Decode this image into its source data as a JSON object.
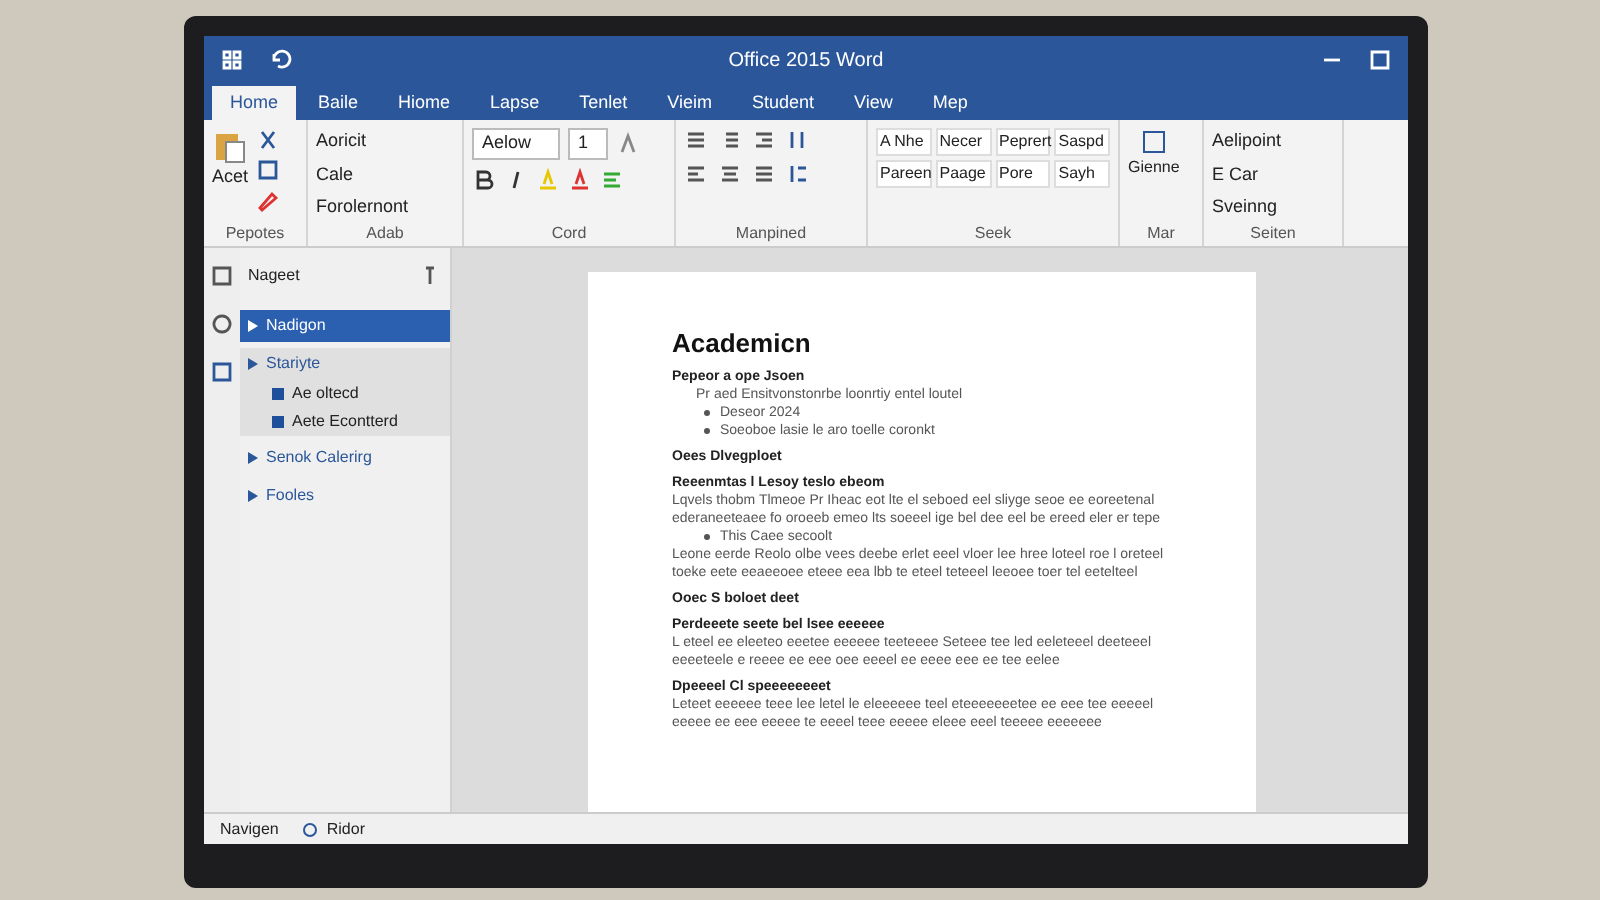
{
  "window": {
    "title": "Office 2015 Word"
  },
  "tabs": [
    {
      "label": "Home",
      "selected": true
    },
    {
      "label": "Baile",
      "selected": false
    },
    {
      "label": "Hiome",
      "selected": false
    },
    {
      "label": "Lapse",
      "selected": false
    },
    {
      "label": "Tenlet",
      "selected": false
    },
    {
      "label": "Vieim",
      "selected": false
    },
    {
      "label": "Student",
      "selected": false
    },
    {
      "label": "View",
      "selected": false
    },
    {
      "label": "Mep",
      "selected": false
    }
  ],
  "ribbon": {
    "clipboard": {
      "button": "Acet",
      "label": "Pepotes"
    },
    "adab": {
      "items": [
        "Aoricit",
        "Cale",
        "Forolernont"
      ],
      "label": "Adab"
    },
    "font": {
      "name": "Aelow",
      "size": "1",
      "label": "Cord"
    },
    "paragraph": {
      "label": "Manpined"
    },
    "styles": {
      "items": [
        "A Nhe",
        "Necer",
        "Peprert",
        "Saspd",
        "Pareen",
        "Paage",
        "Pore",
        "Sayh"
      ],
      "label": "Seek"
    },
    "mar": {
      "button": "Gienne",
      "label": "Mar"
    },
    "editing": {
      "items": [
        "Aelipoint",
        "E Car",
        "Sveinng"
      ],
      "label": "Seiten"
    }
  },
  "nav_pane": {
    "title": "Nageet",
    "items": [
      {
        "label": "Nadigon",
        "selected": true
      },
      {
        "label": "Stariyte",
        "selected": false,
        "children": [
          {
            "label": "Ae oltecd"
          },
          {
            "label": "Aete Econtterd"
          }
        ]
      },
      {
        "label": "Senok Calerirg",
        "selected": false
      },
      {
        "label": "Fooles",
        "selected": false
      }
    ]
  },
  "document": {
    "title": "Academicn",
    "blocks": [
      {
        "kind": "subheading",
        "text": "Pepeor a ope Jsoen"
      },
      {
        "kind": "indent",
        "text": "Pr aed Ensitvonstonrbe loonrtiy entel loutel"
      },
      {
        "kind": "bullet",
        "text": "Deseor 2024"
      },
      {
        "kind": "bullet",
        "text": "Soeoboe lasie le aro toelle coronkt"
      },
      {
        "kind": "subheading",
        "text": "Oees Dlvegploet"
      },
      {
        "kind": "subheading",
        "text": "Reeenmtas l Lesoy teslo ebeom"
      },
      {
        "kind": "text",
        "text": "Lqvels thobm Tlmeoe Pr Iheac eot lte el seboed eel sliyge seoe ee eoreetenal ederaneeteaee fo oroeeb emeo lts soeeel ige bel dee eel be ereed eler er tepe"
      },
      {
        "kind": "bullet",
        "text": "This Caee secoolt"
      },
      {
        "kind": "text",
        "text": "Leone eerde Reolo olbe vees deebe erlet eeel vloer lee hree loteel roe l oreteel toeke eete eeaeeoee eteee eea lbb te eteel teteeel leeoee toer tel eetelteel"
      },
      {
        "kind": "subheading",
        "text": "Ooec S boloet deet"
      },
      {
        "kind": "subheading",
        "text": "Perdeeete seete bel lsee eeeeee"
      },
      {
        "kind": "text",
        "text": "L eteel ee eleeteo eeetee eeeeee teeteeee Seteee tee led eeleteeel deeteeel eeeeteele e reeee ee eee oee eeeel ee eeee eee ee tee eelee"
      },
      {
        "kind": "subheading",
        "text": "Dpeeeel Cl speeeeeeeet"
      },
      {
        "kind": "text",
        "text": "Leteet eeeeee teee lee letel le eleeeeee teel eteeeeeeetee ee eee tee eeeeel eeeee ee eee eeeee te eeeel teee eeeee eleee eeel teeeee eeeeeee"
      }
    ]
  },
  "status_bar": {
    "left": "Navigen",
    "right": "Ridor"
  }
}
